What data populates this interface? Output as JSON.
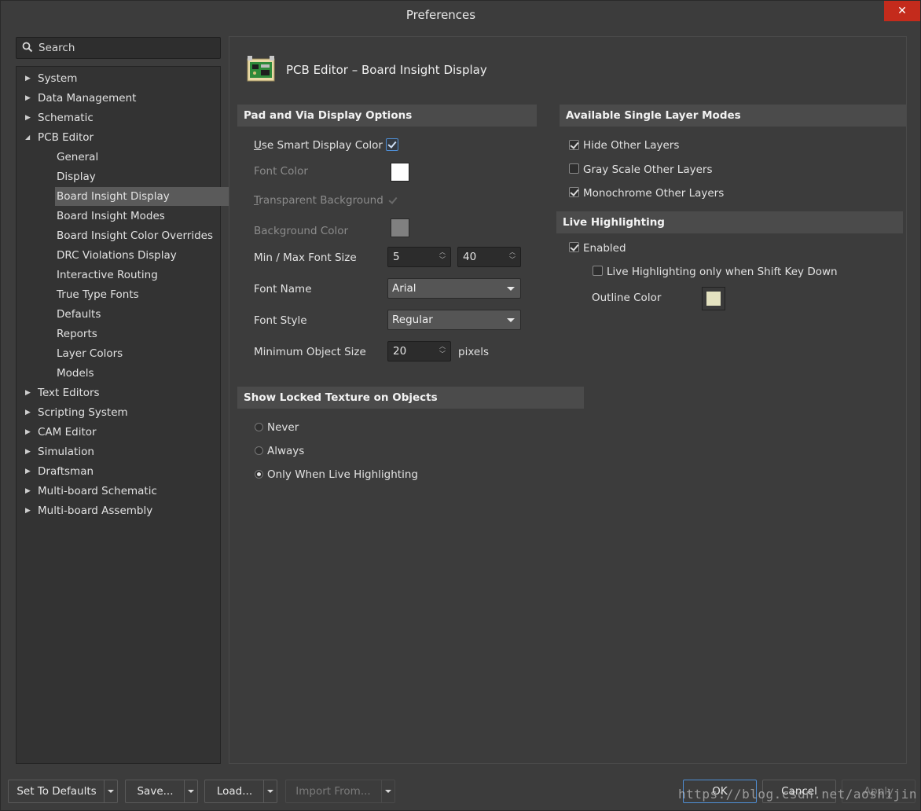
{
  "window": {
    "title": "Preferences",
    "close_glyph": "✕"
  },
  "search": {
    "placeholder": "Search",
    "icon": "search-icon"
  },
  "nav": {
    "items": [
      {
        "label": "System",
        "level": 0,
        "expandable": true
      },
      {
        "label": "Data Management",
        "level": 0,
        "expandable": true
      },
      {
        "label": "Schematic",
        "level": 0,
        "expandable": true
      },
      {
        "label": "PCB Editor",
        "level": 0,
        "expandable": true,
        "expanded": true
      },
      {
        "label": "General",
        "level": 1
      },
      {
        "label": "Display",
        "level": 1
      },
      {
        "label": "Board Insight Display",
        "level": 1,
        "selected": true
      },
      {
        "label": "Board Insight Modes",
        "level": 1
      },
      {
        "label": "Board Insight Color Overrides",
        "level": 1
      },
      {
        "label": "DRC Violations Display",
        "level": 1
      },
      {
        "label": "Interactive Routing",
        "level": 1
      },
      {
        "label": "True Type Fonts",
        "level": 1
      },
      {
        "label": "Defaults",
        "level": 1
      },
      {
        "label": "Reports",
        "level": 1
      },
      {
        "label": "Layer Colors",
        "level": 1
      },
      {
        "label": "Models",
        "level": 1
      },
      {
        "label": "Text Editors",
        "level": 0,
        "expandable": true
      },
      {
        "label": "Scripting System",
        "level": 0,
        "expandable": true
      },
      {
        "label": "CAM Editor",
        "level": 0,
        "expandable": true
      },
      {
        "label": "Simulation",
        "level": 0,
        "expandable": true
      },
      {
        "label": "Draftsman",
        "level": 0,
        "expandable": true
      },
      {
        "label": "Multi-board Schematic",
        "level": 0,
        "expandable": true
      },
      {
        "label": "Multi-board Assembly",
        "level": 0,
        "expandable": true
      }
    ]
  },
  "page": {
    "title": "PCB Editor – Board Insight Display",
    "icon": "pcb-board-icon"
  },
  "pad_via": {
    "header": "Pad and Via Display Options",
    "use_smart_pre": "U",
    "use_smart_rest": "se Smart Display Color",
    "use_smart_checked": true,
    "font_color_label": "Font Color",
    "font_color": "#ffffff",
    "transparent_pre": "T",
    "transparent_rest": "ransparent Background",
    "transparent_checked": true,
    "background_color_label": "Background Color",
    "background_color": "#808080",
    "min_max_label": "Min / Max Font Size",
    "min_font": "5",
    "max_font": "40",
    "font_name_label": "Font Name",
    "font_name": "Arial",
    "font_style_label": "Font Style",
    "font_style": "Regular",
    "min_obj_label": "Minimum Object Size",
    "min_obj": "20",
    "min_obj_unit": "pixels"
  },
  "single_layer": {
    "header": "Available Single Layer Modes",
    "hide_other": "Hide Other Layers",
    "hide_other_checked": true,
    "gray_scale": "Gray Scale Other Layers",
    "gray_scale_checked": false,
    "monochrome": "Monochrome Other Layers",
    "monochrome_checked": true
  },
  "live_highlighting": {
    "header": "Live Highlighting",
    "enabled": "Enabled",
    "enabled_checked": true,
    "shift_only": "Live Highlighting only when Shift Key Down",
    "shift_only_checked": false,
    "outline_label": "Outline Color",
    "outline_color": "#e4e2c0"
  },
  "locked_texture": {
    "header": "Show Locked Texture on Objects",
    "options": [
      "Never",
      "Always",
      "Only When Live Highlighting"
    ],
    "selected": "Only When Live Highlighting"
  },
  "footer": {
    "set_defaults": "Set To Defaults",
    "save": "Save...",
    "load": "Load...",
    "import": "Import From...",
    "ok": "OK",
    "cancel": "Cancel",
    "apply": "Apply"
  },
  "watermark": "https://blog.csdn.net/aoshijin"
}
